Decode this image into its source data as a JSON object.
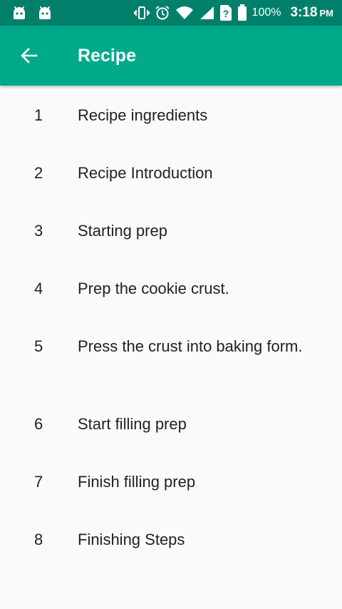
{
  "status_bar": {
    "battery_percent": "100%",
    "time": "3:18",
    "ampm": "PM",
    "icons": [
      "android-icon",
      "android-icon",
      "vibrate-icon",
      "alarm-icon",
      "wifi-icon",
      "signal-icon",
      "unknown-sim-icon",
      "battery-icon"
    ]
  },
  "app_bar": {
    "title": "Recipe",
    "back_icon": "arrow-back-icon",
    "background": "#00a98a"
  },
  "steps": [
    {
      "number": "1",
      "label": "Recipe ingredients"
    },
    {
      "number": "2",
      "label": "Recipe Introduction"
    },
    {
      "number": "3",
      "label": "Starting prep"
    },
    {
      "number": "4",
      "label": "Prep the cookie crust."
    },
    {
      "number": "5",
      "label": "Press the crust into baking form."
    },
    {
      "number": "6",
      "label": "Start filling prep"
    },
    {
      "number": "7",
      "label": "Finish filling prep"
    },
    {
      "number": "8",
      "label": "Finishing Steps"
    }
  ]
}
